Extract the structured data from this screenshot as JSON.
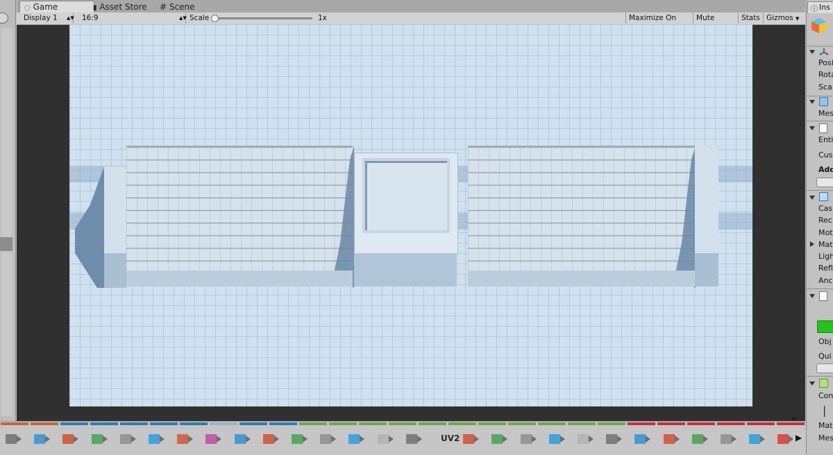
{
  "tabs": [
    {
      "label": "Game"
    },
    {
      "label": "Asset Store"
    },
    {
      "label": "Scene"
    }
  ],
  "toolbar": {
    "display": "Display 1",
    "aspect": "16:9",
    "scale_label": "Scale",
    "scale_value": "1x",
    "maximize_on_play": "Maximize On Play",
    "mute_audio": "Mute Audio",
    "stats": "Stats",
    "gizmos": "Gizmos"
  },
  "inspector": {
    "tab_label": "Ins",
    "transform_rows": [
      "Posi",
      "Rota",
      "Sca"
    ],
    "mesh_rows": [
      "Mes"
    ],
    "entity_rows": [
      "Enti",
      "Cus",
      "Add"
    ],
    "renderer_rows": [
      "Cas",
      "Rec",
      "Moti",
      "Mate",
      "Ligh",
      "Refl",
      "Anc"
    ],
    "obj_rows": [
      "Obj",
      "Qui"
    ],
    "con_rows": [
      "Con",
      "I",
      "I"
    ],
    "bottom_rows": [
      "Mate",
      "Mes"
    ]
  },
  "bottom_toolbar": {
    "uv_label": "UV2",
    "segment_colors": [
      "#c8643c",
      "#c8643c",
      "#2a7fb2",
      "#2a7fb2",
      "#2a7fb2",
      "#2a7fb2",
      "#2a7fb2",
      "#9cb3c8",
      "#2a7fb2",
      "#2a7fb2",
      "#6aa84f",
      "#6aa84f",
      "#6aa84f",
      "#6aa84f",
      "#6aa84f",
      "#6aa84f",
      "#6aa84f",
      "#6aa84f",
      "#6aa84f",
      "#6aa84f",
      "#6aa84f",
      "#c8303c",
      "#c8303c",
      "#c8303c",
      "#c8303c",
      "#c8303c",
      "#c8303c"
    ],
    "tool_icons": [
      "vertex-icon",
      "cube-icon",
      "pivot-icon",
      "delete-icon",
      "select-icon",
      "frame-icon",
      "brick-icon",
      "color-wheel-icon",
      "arrow-icon",
      "add-icon",
      "swap-icon",
      "extrude-icon",
      "split-icon",
      "flip-icon",
      "cube-gray-icon",
      "uv-icon",
      "bridge-icon",
      "merge-icon",
      "bevel-icon",
      "weld-icon",
      "fan-icon",
      "plane-icon",
      "slice-icon",
      "export-icon",
      "merge-arrow-icon",
      "face-icon",
      "detach-icon",
      "mirror-icon"
    ]
  }
}
